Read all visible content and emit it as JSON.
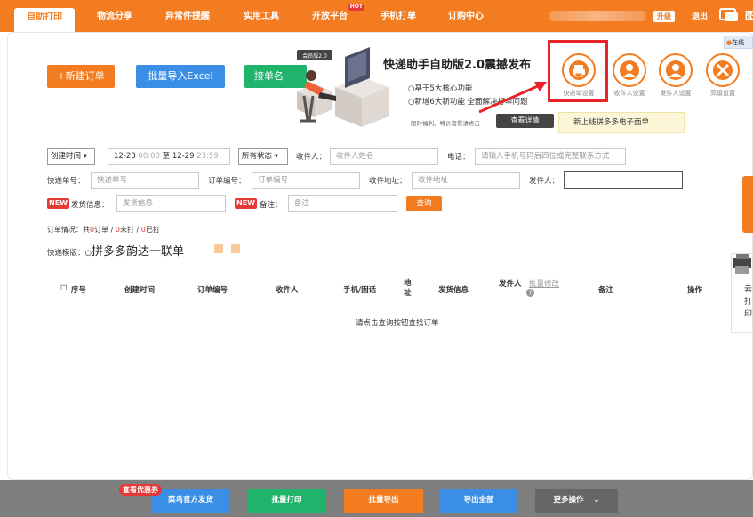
{
  "nav": {
    "tabs": [
      "自助打印",
      "物流分享",
      "异常件提醒",
      "实用工具",
      "开放平台",
      "手机打单",
      "订购中心"
    ],
    "hot_badge": "HOT",
    "upgrade": "升级",
    "logout": "退出",
    "truncated": "图"
  },
  "online": "在线",
  "actions": {
    "new_order": "+新建订单",
    "import_excel": "批量导入Excel",
    "take_name": "接单名"
  },
  "banner": {
    "badge": "会员版2.0",
    "title": "快递助手自助版2.0震撼发布",
    "feature1": "○基于5大核心功能",
    "feature2": "○新增6大新功能 全面解决打单问题",
    "small": "限时福利、特价套餐请点击",
    "detail_button": "查看详情"
  },
  "settings": [
    {
      "label": "快递单设置",
      "icon": "printer-icon"
    },
    {
      "label": "收件人设置",
      "icon": "recipient-icon"
    },
    {
      "label": "发件人设置",
      "icon": "sender-icon"
    },
    {
      "label": "高级设置",
      "icon": "tools-icon"
    }
  ],
  "tooltip": "新上线拼多多电子面单",
  "filters": {
    "time_select": "创建时间",
    "time_range_start": "12-23",
    "time_start_clock": "00:00",
    "to": "至",
    "time_range_end": "12-29",
    "time_end_clock": "23:59",
    "status_select": "所有状态",
    "recipient_label": "收件人：",
    "recipient_placeholder": "收件人姓名",
    "phone_label": "电话：",
    "phone_placeholder": "请输入手机号码后四位或完整联系方式",
    "tracking_label": "快递单号：",
    "tracking_placeholder": "快递单号",
    "order_no_label": "订单编号：",
    "order_no_placeholder": "订单编号",
    "address_label": "收件地址：",
    "address_placeholder": "收件地址",
    "sender_label": "发件人：",
    "new_badge": "NEW",
    "ship_info_label": "发货信息：",
    "ship_info_placeholder": "发货信息",
    "remark_label": "备注：",
    "remark_placeholder": "备注",
    "query_button": "查询"
  },
  "status": {
    "prefix": "订单情况：共",
    "total": "0",
    "total_unit": "订单 / ",
    "unprinted": "0",
    "unprinted_unit": "未打 / ",
    "printed": "0",
    "printed_unit": "已打"
  },
  "template": {
    "label": "快递模版：",
    "name": "拼多多韵达一联单"
  },
  "table": {
    "columns": [
      "序号",
      "创建时间",
      "订单编号",
      "收件人",
      "手机/固话",
      "地址",
      "发货信息",
      "发件人",
      "批量修改",
      "备注",
      "操作"
    ],
    "empty": "请点击查询按钮查找订单"
  },
  "right_card": [
    "云",
    "打",
    "印"
  ],
  "bottom": {
    "coupon": "查看优惠券",
    "buttons": [
      {
        "label": "菜鸟官方发货",
        "color": "#3a8ee6"
      },
      {
        "label": "批量打印",
        "color": "#1fb36b"
      },
      {
        "label": "批量导出",
        "color": "#f27c1f"
      },
      {
        "label": "导出全部",
        "color": "#3a8ee6"
      },
      {
        "label": "更多操作",
        "color": "#666666"
      }
    ]
  },
  "colors": {
    "brand": "#f27c1f",
    "alert": "#e8232a"
  }
}
